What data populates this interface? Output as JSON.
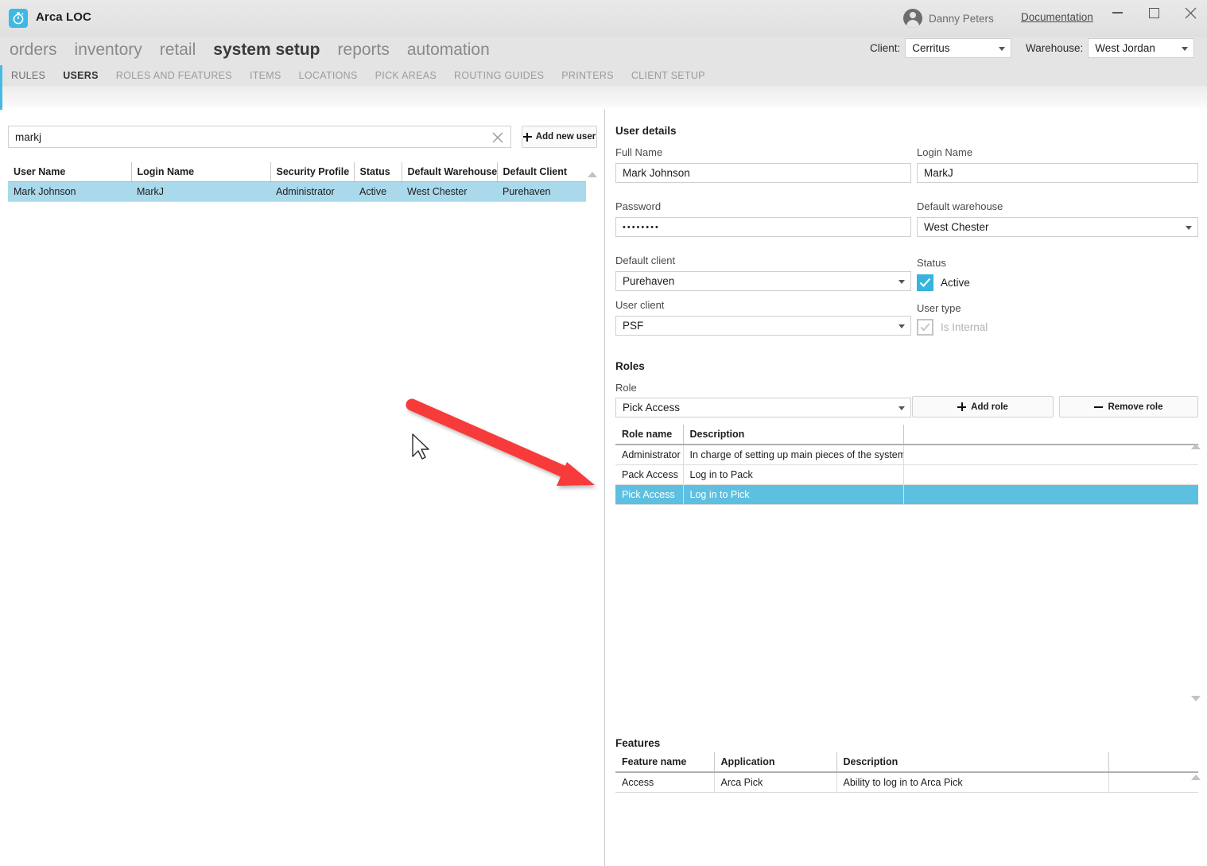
{
  "window": {
    "app_title": "Arca LOC",
    "app_icon": "stopwatch-icon",
    "user_name": "Danny Peters",
    "documentation_link": "Documentation",
    "minimize": "minimize-icon",
    "maximize": "maximize-icon",
    "close": "close-icon"
  },
  "mainnav": {
    "items": [
      {
        "label": "orders",
        "active": false
      },
      {
        "label": "inventory",
        "active": false
      },
      {
        "label": "retail",
        "active": false
      },
      {
        "label": "system setup",
        "active": true
      },
      {
        "label": "reports",
        "active": false
      },
      {
        "label": "automation",
        "active": false
      }
    ]
  },
  "context": {
    "client_label": "Client:",
    "client_value": "Cerritus",
    "warehouse_label": "Warehouse:",
    "warehouse_value": "West Jordan"
  },
  "subnav": {
    "items": [
      {
        "label": "RULES",
        "state": "dark"
      },
      {
        "label": "USERS",
        "state": "active"
      },
      {
        "label": "ROLES AND FEATURES",
        "state": "normal"
      },
      {
        "label": "ITEMS",
        "state": "normal"
      },
      {
        "label": "LOCATIONS",
        "state": "normal"
      },
      {
        "label": "PICK AREAS",
        "state": "normal"
      },
      {
        "label": "ROUTING GUIDES",
        "state": "normal"
      },
      {
        "label": "PRINTERS",
        "state": "normal"
      },
      {
        "label": "CLIENT SETUP",
        "state": "normal"
      }
    ]
  },
  "left": {
    "search_value": "markj",
    "search_placeholder": "",
    "clear_icon": "clear-icon",
    "add_user_label": "Add new user",
    "users_table": {
      "columns": [
        "User Name",
        "Login Name",
        "Security Profile",
        "Status",
        "Default Warehouse",
        "Default Client"
      ],
      "rows": [
        {
          "cells": [
            "Mark Johnson",
            "MarkJ",
            "Administrator",
            "Active",
            "West Chester",
            "Purehaven"
          ],
          "selected": true
        }
      ]
    }
  },
  "right": {
    "user_details_title": "User details",
    "fields": {
      "full_name_label": "Full Name",
      "full_name_value": "Mark Johnson",
      "login_name_label": "Login Name",
      "login_name_value": "MarkJ",
      "password_label": "Password",
      "password_value": "••••••••",
      "default_warehouse_label": "Default warehouse",
      "default_warehouse_value": "West Chester",
      "default_client_label": "Default client",
      "default_client_value": "Purehaven",
      "user_client_label": "User client",
      "user_client_value": "PSF",
      "status_label": "Status",
      "status_checkbox_label": "Active",
      "status_checked": true,
      "user_type_label": "User type",
      "user_type_checkbox_label": "Is Internal",
      "user_type_checked": true,
      "user_type_disabled": true
    },
    "roles": {
      "section_title": "Roles",
      "role_label": "Role",
      "role_value": "Pick Access",
      "add_role_label": "Add role",
      "remove_role_label": "Remove role",
      "columns": [
        "Role name",
        "Description",
        ""
      ],
      "rows": [
        {
          "cells": [
            "Administrator",
            "In charge of setting up main pieces of the system.",
            ""
          ],
          "selected": false
        },
        {
          "cells": [
            "Pack Access",
            "Log in to Pack",
            ""
          ],
          "selected": false
        },
        {
          "cells": [
            "Pick Access",
            "Log in to Pick",
            ""
          ],
          "selected": true
        }
      ]
    },
    "features": {
      "section_title": "Features",
      "columns": [
        "Feature name",
        "Application",
        "Description",
        ""
      ],
      "rows": [
        {
          "cells": [
            "Access",
            "Arca Pick",
            "Ability to log in to Arca Pick",
            ""
          ],
          "selected": false
        }
      ]
    }
  },
  "annotations": {
    "arrow_color": "#f73b3b",
    "cursor": "mouse-pointer"
  },
  "colors": {
    "accent": "#44bbe4",
    "row_selected_left": "#a9d9ea",
    "row_selected_right": "#5dc0e0",
    "checkbox_on": "#36b4dd"
  }
}
